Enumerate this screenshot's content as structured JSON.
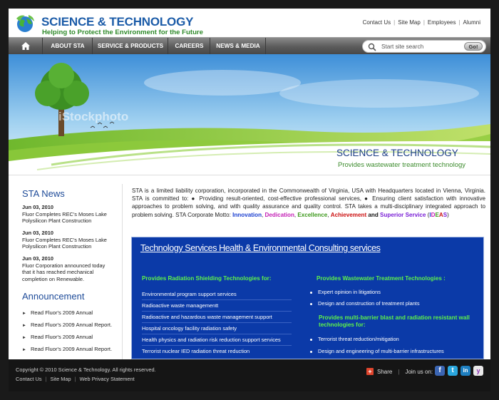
{
  "header": {
    "logo_title": "SCIENCE & TECHNOLOGY",
    "tagline": "Helping to Protect the Environment for the Future",
    "top_links": [
      "Contact Us",
      "Site Map",
      "Employees",
      "Alumni"
    ]
  },
  "nav": {
    "items": [
      "ABOUT STA",
      "SERVICE & PRODUCTS",
      "CAREERS",
      "NEWS & MEDIA"
    ],
    "search_placeholder": "Start site search",
    "go_label": "Go!"
  },
  "banner": {
    "title": "SCIENCE & TECHNOLOGY",
    "subtitle": "Provides wastewater treatment technology",
    "watermark": "iStockphoto"
  },
  "news": {
    "title": "STA News",
    "items": [
      {
        "date": "Jun 03, 2010",
        "text": "Fluor Completes REC's Moses Lake Polysilicon Plant Construction"
      },
      {
        "date": "Jun 03, 2010",
        "text": "Fluor Completes REC's Moses Lake Polysilicon Plant Construction"
      },
      {
        "date": "Jun 03, 2010",
        "text": "Fluor Corporation announced today that it has reached mechanical completion on Renewable."
      }
    ]
  },
  "announcement": {
    "title": "Announcement",
    "items": [
      "Read Fluor's 2009 Annual",
      "Read Fluor's 2009 Annual Report.",
      "Read Fluor's 2009 Annual",
      "Read Fluor's 2009 Annual Report."
    ]
  },
  "intro": {
    "text": "STA is a limited liability corporation, incorporated in the Commonwealth of Virginia, USA with Headquarters located in Vienna, Virginia. STA is committed to: ● Providing result-oriented, cost-effective professional services, ● Ensuring client satisfaction with innovative approaches to problem solving, and with quality assurance and quality control. STA takes a multi-disciplinary integrated approach to problem solving. STA Corporate Motto: ",
    "innovation": "Innovation",
    "dedication": "Dedication",
    "excellence": "Excellence",
    "achievement": "Achievement",
    "and": "and",
    "superior": "Superior Service",
    "comma": ", ",
    "open_paren": " (",
    "ideas_i": "I",
    "ideas_d": "D",
    "ideas_e": "E",
    "ideas_a": "A",
    "ideas_s": "S",
    "close_paren": ")"
  },
  "services": {
    "title": "Technology Services  Health & Environmental Consulting services",
    "left_head": "Provides Radiation Shielding Technologies for:",
    "left_items": [
      "Environmental program support services",
      "Radioactive waste managementt",
      "Radioactive and hazardous waste management support",
      "Hospital oncology facility radiation safety",
      "Health physics and radiation risk reduction support services",
      "Terrorist nuclear IED radiation threat reduction"
    ],
    "right_head": "Provides Wastewater Treatment Technologies :",
    "right_items": [
      "Expert opinion in litigations",
      "Design and construction of treatment plants"
    ],
    "right_head2": "Provides multi-barrier blast and radiation resistant wall technologies for:",
    "right_items2": [
      "Terrorist threat reduction/mitigation",
      "Design and engineering of multi-barrier infrastructures"
    ]
  },
  "footer": {
    "copyright": "Copyright © 2010 Science & Technology. All rights reserved.",
    "links": [
      "Contact Us",
      "Site Map",
      "Web Privacy Statement"
    ],
    "share": "Share",
    "join": "Join us on:",
    "social": [
      "f",
      "t",
      "in",
      "y"
    ]
  },
  "colors": {
    "brand_blue": "#1c5ca8",
    "brand_green": "#2f8a2a",
    "services_bg": "#0b3aa8",
    "services_head": "#5ef24a"
  }
}
